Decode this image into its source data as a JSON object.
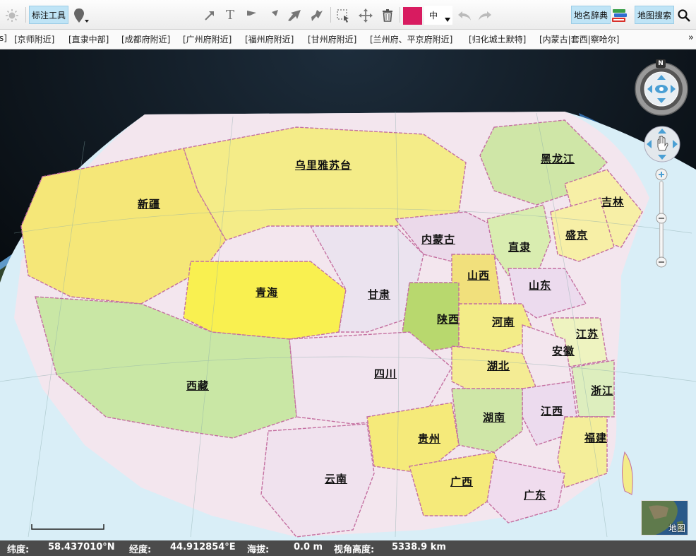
{
  "toolbar": {
    "annotate_label": "标注工具",
    "color_swatch": "#d81b60",
    "size_value": "中",
    "gazetteer_label": "地名辞典",
    "map_search_label": "地图搜索",
    "icons": [
      "sun-icon",
      "marker-icon",
      "freehand-icon",
      "polyline-icon",
      "polygon-icon",
      "rectangle-icon",
      "circle-icon",
      "arrow-icon",
      "text-icon",
      "flag-icon",
      "arrow-tool-icon",
      "fat-arrow-icon",
      "curve-arrow-icon",
      "select-icon",
      "move-icon",
      "delete-icon",
      "undo-icon",
      "redo-icon",
      "books-icon",
      "search-icon"
    ]
  },
  "places": {
    "items": [
      "s]",
      "[京师附近]",
      "[直隶中部]",
      "[成都府附近]",
      "[广州府附近]",
      "[福州府附近]",
      "[甘州府附近]",
      "[兰州府、平京府附近]",
      "[归化城土默特]",
      "[内蒙古|套西|察哈尔]"
    ],
    "more": "»"
  },
  "map": {
    "provinces": [
      "乌里雅苏台",
      "黑龙江",
      "吉林",
      "新疆",
      "内蒙古",
      "直隶",
      "盛京",
      "山西",
      "山东",
      "青海",
      "甘肃",
      "陕西",
      "河南",
      "江苏",
      "安徽",
      "四川",
      "湖北",
      "西藏",
      "浙江",
      "江西",
      "湖南",
      "贵州",
      "福建",
      "云南",
      "广西",
      "广东"
    ],
    "compass_n": "N",
    "overview_label": "地图"
  },
  "status": {
    "lat_label": "纬度:",
    "lat_value": "58.437010°N",
    "lon_label": "经度:",
    "lon_value": "44.912854°E",
    "alt_label": "海拔:",
    "alt_value": "0.0 m",
    "view_label": "视角高度:",
    "view_value": "5338.9 km"
  }
}
